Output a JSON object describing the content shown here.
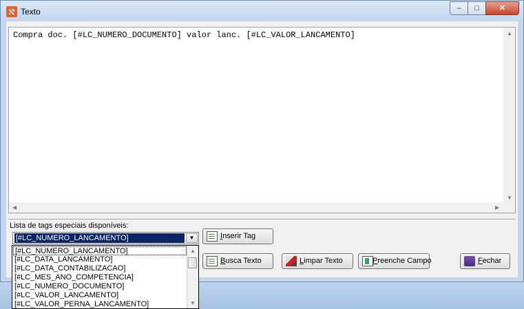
{
  "window": {
    "title": "Texto",
    "minimize": "–",
    "maximize": "□",
    "close": "✕"
  },
  "editor": {
    "text": "Compra doc. [#LC_NUMERO_DOCUMENTO] valor lanc. [#LC_VALOR_LANCAMENTO]"
  },
  "tags": {
    "label": "Lista de tags especiais disponíveis:",
    "selected": "[#LC_NUMERO_LANCAMENTO]",
    "options": [
      "[#LC_NUMERO_LANCAMENTO]",
      "[#LC_DATA_LANCAMENTO]",
      "[#LC_DATA_CONTABILIZACAO]",
      "[#LC_MES_ANO_COMPETENCIA]",
      "[#LC_NUMERO_DOCUMENTO]",
      "[#LC_VALOR_LANCAMENTO]",
      "[#LC_VALOR_PERNA_LANCAMENTO]"
    ]
  },
  "buttons": {
    "insert_tag": {
      "u": "I",
      "rest": "nserir Tag",
      "icon": "insert-doc-icon"
    },
    "search_text": {
      "u": "B",
      "rest": "usca Texto",
      "icon": "search-doc-icon"
    },
    "clear_text": {
      "u": "L",
      "rest": "impar Texto",
      "icon": "eraser-icon"
    },
    "fill_field": {
      "u": "P",
      "rest": "reenche Campo",
      "icon": "fill-field-icon"
    },
    "close": {
      "u": "F",
      "rest": "echar",
      "icon": "exit-door-icon"
    }
  },
  "colors": {
    "selection": "#0a246a",
    "close_button": "#c8452b"
  }
}
